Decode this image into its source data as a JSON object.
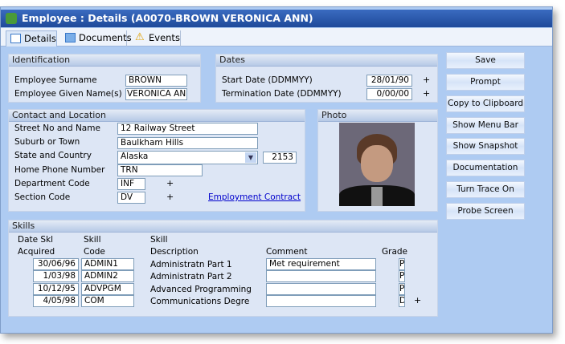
{
  "window": {
    "title": "Employee : Details (A0070-BROWN VERONICA ANN)"
  },
  "tabs": [
    {
      "label": "Details"
    },
    {
      "label": "Documents"
    },
    {
      "label": "Events"
    }
  ],
  "identification": {
    "heading": "Identification",
    "surname_label": "Employee Surname",
    "surname": "BROWN",
    "given_label": "Employee Given Name(s)",
    "given": "VERONICA AN"
  },
  "dates": {
    "heading": "Dates",
    "start_label": "Start Date (DDMMYY)",
    "start": "28/01/90",
    "term_label": "Termination Date (DDMMYY)",
    "term": "0/00/00",
    "plus": "+"
  },
  "contact": {
    "heading": "Contact and Location",
    "street_label": "Street No and Name",
    "street": "12 Railway Street",
    "suburb_label": "Suburb or Town",
    "suburb": "Baulkham Hills",
    "state_label": "State and Country",
    "state": "Alaska",
    "postcode": "2153",
    "phone_label": "Home Phone Number",
    "phone": "TRN",
    "dept_label": "Department Code",
    "dept": "INF",
    "section_label": "Section Code",
    "section": "DV",
    "plus": "+",
    "link": "Employment Contract"
  },
  "photo": {
    "heading": "Photo"
  },
  "buttons": [
    "Save",
    "Prompt",
    "Copy to Clipboard",
    "Show Menu Bar",
    "Show Snapshot",
    "Documentation",
    "Turn Trace On",
    "Probe Screen"
  ],
  "skills": {
    "heading": "Skills",
    "headers": {
      "date1": "Date Skl",
      "date2": "Acquired",
      "code1": "Skill",
      "code2": "Code",
      "desc1": "Skill",
      "desc2": "Description",
      "comment": "Comment",
      "grade": "Grade"
    },
    "rows": [
      {
        "date": "30/06/96",
        "code": "ADMIN1",
        "desc": "Administratn Part 1",
        "comment": "Met requirement",
        "grade": "P"
      },
      {
        "date": "1/03/98",
        "code": "ADMIN2",
        "desc": "Administratn Part 2",
        "comment": "",
        "grade": "P"
      },
      {
        "date": "10/12/95",
        "code": "ADVPGM",
        "desc": "Advanced Programming",
        "comment": "",
        "grade": "P"
      },
      {
        "date": "4/05/98",
        "code": "COM",
        "desc": "Communications Degre",
        "comment": "",
        "grade": "D"
      }
    ],
    "plus": "+"
  }
}
